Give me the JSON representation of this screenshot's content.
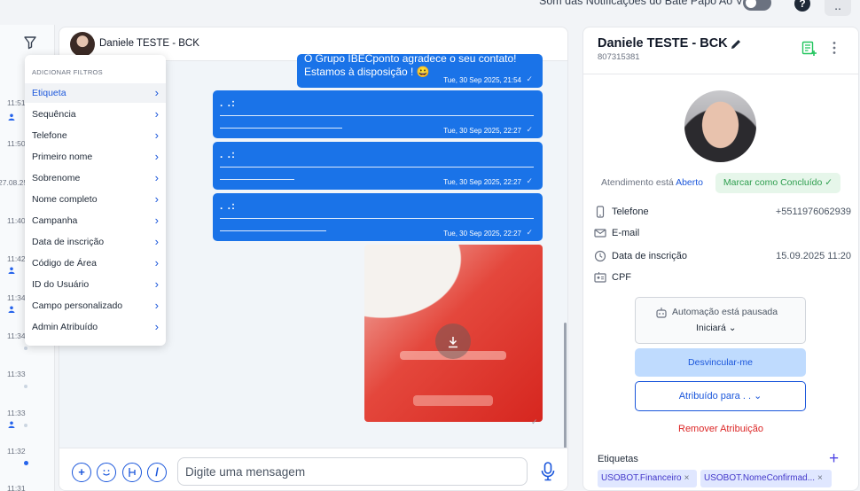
{
  "topbar": {
    "notif_label": "Som das Notificações do Bate Papo Ao Vivo",
    "help": "?",
    "more": ".."
  },
  "left_list": {
    "times": [
      "11:51",
      "11:50",
      "27.08.25",
      "11:40",
      "11:42",
      "11:34",
      "11:34",
      "11:33",
      "11:33",
      "11:32",
      "11:31"
    ]
  },
  "filter_menu": {
    "title": "ADICIONAR FILTROS",
    "items": [
      "Etiqueta",
      "Sequência",
      "Telefone",
      "Primeiro nome",
      "Sobrenome",
      "Nome completo",
      "Campanha",
      "Data de inscrição",
      "Código de Área",
      "ID do Usuário",
      "Campo personalizado",
      "Admin Atribuído"
    ],
    "active_index": 0
  },
  "chat": {
    "contact_name": "Daniele TESTE - BCK",
    "messages": [
      {
        "line1": "O Grupo IBECponto agradece o seu contato!",
        "line2": "Estamos à disposição ! 😀",
        "time": "Tue, 30 Sep 2025, 21:54"
      },
      {
        "text": ". .:",
        "time": "Tue, 30 Sep 2025, 22:27"
      },
      {
        "text": ". .:",
        "time": "Tue, 30 Sep 2025, 22:27"
      },
      {
        "text": ". .:",
        "time": "Tue, 30 Sep 2025, 22:27"
      }
    ],
    "tick": "✓",
    "input_placeholder": "Digite uma mensagem"
  },
  "contact": {
    "name": "Daniele TESTE - BCK",
    "id": "807315381",
    "status_prefix": "Atendimento está",
    "status_value": "Aberto",
    "done_button": "Marcar como Concluído ✓",
    "fields": [
      {
        "label": "Telefone",
        "value": "+5511976062939",
        "icon": "phone-icon"
      },
      {
        "label": "E-mail",
        "value": "",
        "icon": "mail-icon"
      },
      {
        "label": "Data de inscrição",
        "value": "15.09.2025 11:20",
        "icon": "clock-icon"
      },
      {
        "label": "CPF",
        "value": "",
        "icon": "id-card-icon"
      }
    ],
    "automation_text": "Automação está pausada",
    "automation_sub": "Iniciará ⌄",
    "unlink_button": "Desvincular-me",
    "assign_button": "Atribuído para  . .  ⌄",
    "remove_link": "Remover Atribuição",
    "tags_label": "Etiquetas",
    "tags_add": "+",
    "tags": [
      "USOBOT.Financeiro",
      "USOBOT.NomeConfirmad..."
    ],
    "tag_remove": "×"
  },
  "colors": {
    "accent": "#1a56db",
    "bubble": "#1a73e8",
    "done_green": "#2e9e4f",
    "danger": "#dc2626"
  }
}
